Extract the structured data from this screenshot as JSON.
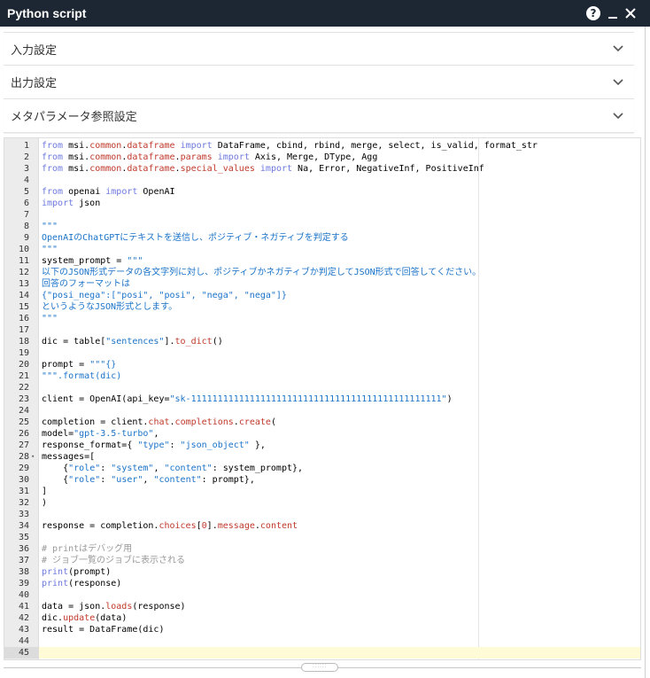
{
  "window": {
    "title": "Python script"
  },
  "sections": [
    {
      "label": "入力設定"
    },
    {
      "label": "出力設定"
    },
    {
      "label": "メタパラメータ参照設定"
    }
  ],
  "icons": {
    "help": "help-icon",
    "minimize": "minimize-icon",
    "close": "close-icon",
    "expand": "chevron-down-icon"
  },
  "editor": {
    "active_line": 45,
    "lines": [
      {
        "n": "1",
        "t": "from msi.common.dataframe import DataFrame, cbind, rbind, merge, select, is_valid, format_str"
      },
      {
        "n": "2",
        "t": "from msi.common.dataframe.params import Axis, Merge, DType, Agg"
      },
      {
        "n": "3",
        "t": "from msi.common.dataframe.special_values import Na, Error, NegativeInf, PositiveInf"
      },
      {
        "n": "4",
        "t": ""
      },
      {
        "n": "5",
        "t": "from openai import OpenAI"
      },
      {
        "n": "6",
        "t": "import json"
      },
      {
        "n": "7",
        "t": ""
      },
      {
        "n": "8",
        "t": "\"\"\""
      },
      {
        "n": "9",
        "t": "OpenAIのChatGPTにテキストを送信し、ポジティブ・ネガティブを判定する"
      },
      {
        "n": "10",
        "t": "\"\"\""
      },
      {
        "n": "11",
        "t": "system_prompt = \"\"\""
      },
      {
        "n": "12",
        "t": "以下のJSON形式データの各文字列に対し、ポジティブかネガティブか判定してJSON形式で回答してください。"
      },
      {
        "n": "13",
        "t": "回答のフォーマットは"
      },
      {
        "n": "14",
        "t": "{\"posi_nega\":[\"posi\", \"posi\", \"nega\", \"nega\"]}"
      },
      {
        "n": "15",
        "t": "というようなJSON形式とします。"
      },
      {
        "n": "16",
        "t": "\"\"\""
      },
      {
        "n": "17",
        "t": ""
      },
      {
        "n": "18",
        "t": "dic = table[\"sentences\"].to_dict()"
      },
      {
        "n": "19",
        "t": ""
      },
      {
        "n": "20",
        "t": "prompt = \"\"\"{}"
      },
      {
        "n": "21",
        "t": "\"\"\".format(dic)"
      },
      {
        "n": "22",
        "t": ""
      },
      {
        "n": "23",
        "t": "client = OpenAI(api_key=\"sk-11111111111111111111111111111111111111111111111\")"
      },
      {
        "n": "24",
        "t": ""
      },
      {
        "n": "25",
        "t": "completion = client.chat.completions.create("
      },
      {
        "n": "26",
        "t": "model=\"gpt-3.5-turbo\","
      },
      {
        "n": "27",
        "t": "response_format={ \"type\": \"json_object\" },"
      },
      {
        "n": "28",
        "t": "messages=["
      },
      {
        "n": "29",
        "t": "    {\"role\": \"system\", \"content\": system_prompt},"
      },
      {
        "n": "30",
        "t": "    {\"role\": \"user\", \"content\": prompt},"
      },
      {
        "n": "31",
        "t": "]"
      },
      {
        "n": "32",
        "t": ")"
      },
      {
        "n": "33",
        "t": ""
      },
      {
        "n": "34",
        "t": "response = completion.choices[0].message.content"
      },
      {
        "n": "35",
        "t": ""
      },
      {
        "n": "36",
        "t": "# printはデバッグ用"
      },
      {
        "n": "37",
        "t": "# ジョブ一覧のジョブに表示される"
      },
      {
        "n": "38",
        "t": "print(prompt)"
      },
      {
        "n": "39",
        "t": "print(response)"
      },
      {
        "n": "40",
        "t": ""
      },
      {
        "n": "41",
        "t": "data = json.loads(response)"
      },
      {
        "n": "42",
        "t": "dic.update(data)"
      },
      {
        "n": "43",
        "t": "result = DataFrame(dic)"
      },
      {
        "n": "44",
        "t": ""
      },
      {
        "n": "45",
        "t": ""
      }
    ]
  }
}
